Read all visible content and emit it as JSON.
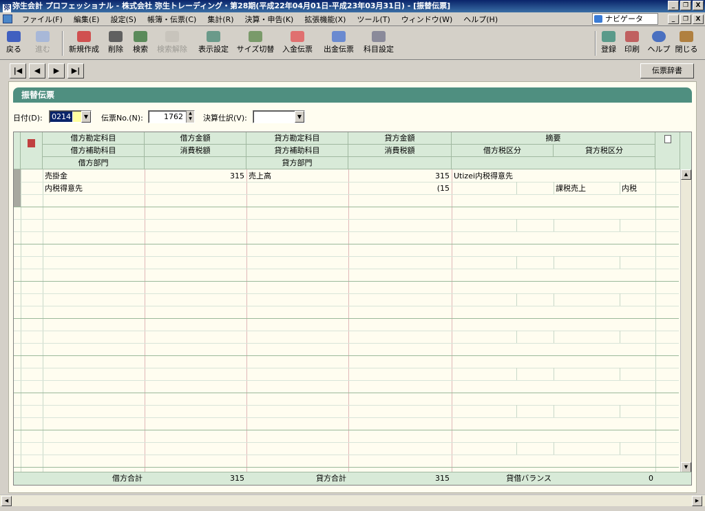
{
  "window": {
    "title": "弥生会計 プロフェッショナル - 株式会社 弥生トレーディング・第28期(平成22年04月01日-平成23年03月31日) - [振替伝票]",
    "controls": [
      "_",
      "❐",
      "X"
    ]
  },
  "menu": {
    "items": [
      "ファイル(F)",
      "編集(E)",
      "設定(S)",
      "帳簿・伝票(C)",
      "集計(R)",
      "決算・申告(K)",
      "拡張機能(X)",
      "ツール(T)",
      "ウィンドウ(W)",
      "ヘルプ(H)"
    ],
    "navigator": "ナビゲータ"
  },
  "toolbar": {
    "back": "戻る",
    "forward": "進む",
    "new": "新規作成",
    "delete": "削除",
    "search": "検索",
    "clear_search": "検索解除",
    "display_settings": "表示設定",
    "size_toggle": "サイズ切替",
    "receipt_slip": "入金伝票",
    "payment_slip": "出金伝票",
    "account_settings": "科目設定",
    "register": "登録",
    "print": "印刷",
    "help": "ヘルプ",
    "close": "閉じる"
  },
  "nav": {
    "first": "|◀",
    "prev": "◀",
    "next": "▶",
    "last": "▶|",
    "dictionary": "伝票辞書"
  },
  "panel": {
    "title": "振替伝票",
    "date_label": "日付(D):",
    "date_value": "0214",
    "slip_no_label": "伝票No.(N):",
    "slip_no_value": "1762",
    "settlement_label": "決算仕訳(V):",
    "settlement_value": ""
  },
  "grid": {
    "headers_row1": [
      "借方勘定科目",
      "借方金額",
      "貸方勘定科目",
      "貸方金額",
      "摘要"
    ],
    "headers_row2": [
      "借方補助科目",
      "消費税額",
      "貸方補助科目",
      "消費税額",
      "借方税区分",
      "貸方税区分"
    ],
    "headers_row3": [
      "借方部門",
      "貸方部門"
    ],
    "entry": {
      "debit_account": "売掛金",
      "debit_amount": "315",
      "credit_account": "売上高",
      "credit_amount": "315",
      "memo": "Utizei内税得意先",
      "debit_sub": "内税得意先",
      "credit_tax": "(15",
      "credit_tax_class": "課税売上",
      "credit_tax_type": "内税"
    },
    "footer": {
      "debit_total_label": "借方合計",
      "debit_total": "315",
      "credit_total_label": "貸方合計",
      "credit_total": "315",
      "balance_label": "貸借バランス",
      "balance": "0"
    }
  },
  "colors": {
    "title_gradient_start": "#0a246a",
    "panel_header": "#4f8f80",
    "grid_header": "#d8ead8"
  }
}
